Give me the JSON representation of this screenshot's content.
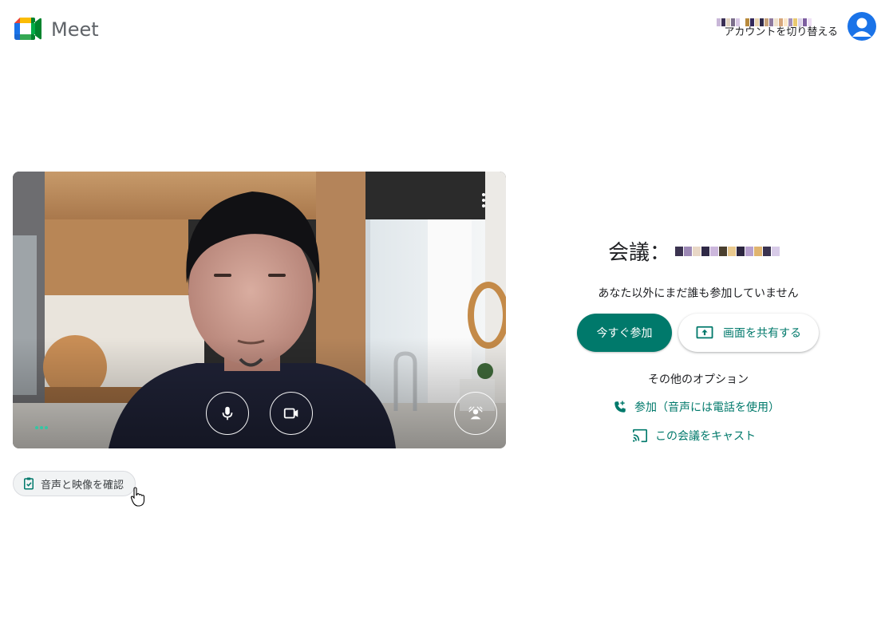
{
  "header": {
    "brand": "Meet",
    "account_switch": "アカウントを切り替える"
  },
  "preview": {
    "controls": {
      "mic": "microphone-icon",
      "camera": "video-camera-icon",
      "effects": "background-effects-icon",
      "more": "more-vert-icon"
    }
  },
  "check": {
    "label": "音声と映像を確認"
  },
  "meeting": {
    "title_prefix": "会議：",
    "status": "あなた以外にまだ誰も参加していません",
    "join_label": "今すぐ参加",
    "share_label": "画面を共有する",
    "other_options": "その他のオプション",
    "phone_join": "参加（音声には電話を使用）",
    "cast": "この会議をキャスト"
  },
  "colors": {
    "accent": "#00796b",
    "avatar": "#1a73e8"
  }
}
